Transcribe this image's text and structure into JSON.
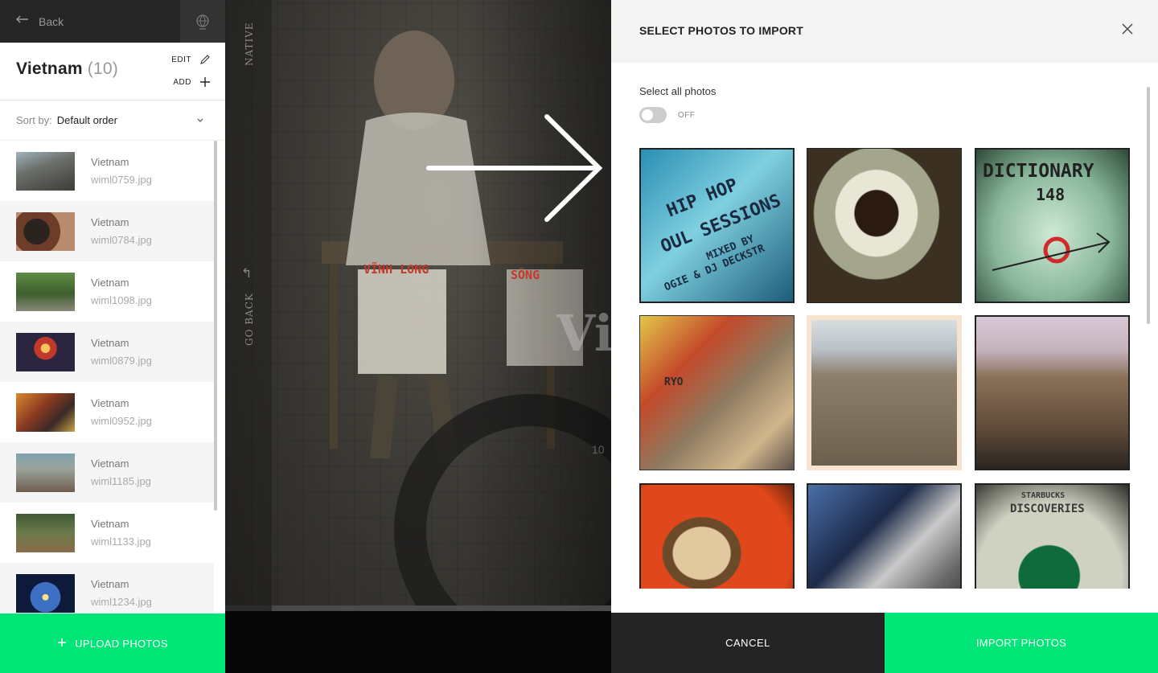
{
  "sidebar": {
    "back_label": "Back",
    "album": {
      "title": "Vietnam",
      "count": "(10)"
    },
    "edit_label": "EDIT",
    "add_label": "ADD",
    "sort": {
      "label": "Sort by:",
      "value": "Default order"
    },
    "photos": [
      {
        "album": "Vietnam",
        "file": "wiml0759.jpg"
      },
      {
        "album": "Vietnam",
        "file": "wiml0784.jpg"
      },
      {
        "album": "Vietnam",
        "file": "wiml1098.jpg"
      },
      {
        "album": "Vietnam",
        "file": "wiml0879.jpg"
      },
      {
        "album": "Vietnam",
        "file": "wiml0952.jpg"
      },
      {
        "album": "Vietnam",
        "file": "wiml1185.jpg"
      },
      {
        "album": "Vietnam",
        "file": "wiml1133.jpg"
      },
      {
        "album": "Vietnam",
        "file": "wiml1234.jpg"
      }
    ],
    "upload_label": "UPLOAD PHOTOS"
  },
  "preview": {
    "native_label": "NATIVE",
    "go_back_label": "GO BACK",
    "big_text": "Vi",
    "count_text": "10",
    "sign_left": "VĨNH LONG",
    "sign_right": "SÔNG"
  },
  "import_panel": {
    "title": "SELECT PHOTOS TO IMPORT",
    "select_all_label": "Select all photos",
    "toggle_state": "OFF",
    "cancel_label": "CANCEL",
    "import_label": "IMPORT PHOTOS",
    "tiles": [
      {
        "subject": "hip hop soul sessions cover",
        "text_1": "HIP HOP",
        "text_2": "OUL SESSIONS",
        "text_3": "MIXED BY",
        "text_4": "OGIE & DJ DECKSTR"
      },
      {
        "subject": "coffee cup with spoon"
      },
      {
        "subject": "dictionary 148 with target",
        "text_1": "DICTIONARY",
        "text_2": "148"
      },
      {
        "subject": "magazines and cards",
        "text_1": "RYO"
      },
      {
        "subject": "beach with dog"
      },
      {
        "subject": "field with dog"
      },
      {
        "subject": "coffee mug on orange table"
      },
      {
        "subject": "cds and magazine"
      },
      {
        "subject": "starbucks cup",
        "text_1": "STARBUCKS",
        "text_2": "DISCOVERIES"
      }
    ]
  },
  "colors": {
    "accent_green": "#00e676",
    "topbar": "#262626",
    "cancel_bg": "#242424"
  }
}
